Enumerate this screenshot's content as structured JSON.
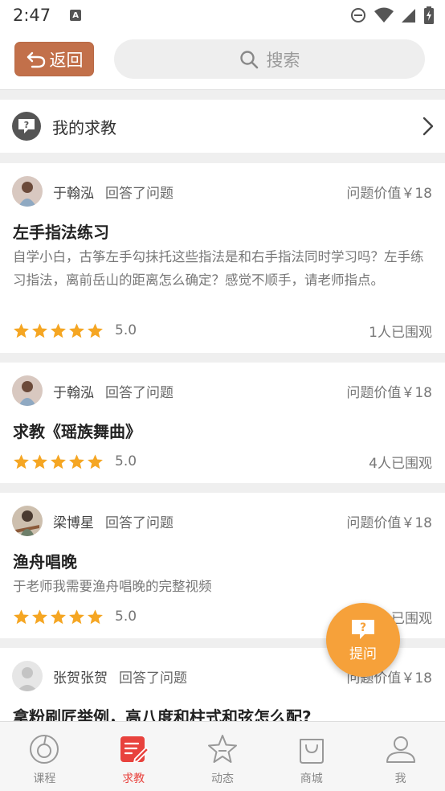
{
  "status": {
    "time": "2:47",
    "notif_letter": "A"
  },
  "header": {
    "back_label": "返回",
    "search_placeholder": "搜索"
  },
  "my_help": {
    "label": "我的求教"
  },
  "cards": [
    {
      "user": "于翰泓",
      "action": "回答了问题",
      "value": "问题价值￥18",
      "title": "左手指法练习",
      "desc": "自学小白，古筝左手勾抹托这些指法是和右手指法同时学习吗？左手练习指法，离前岳山的距离怎么确定？感觉不顺手，请老师指点。",
      "rating": 5,
      "score": "5.0",
      "watchers": "1人已围观"
    },
    {
      "user": "于翰泓",
      "action": "回答了问题",
      "value": "问题价值￥18",
      "title": "求教《瑶族舞曲》",
      "desc": "",
      "rating": 5,
      "score": "5.0",
      "watchers": "4人已围观"
    },
    {
      "user": "梁博星",
      "action": "回答了问题",
      "value": "问题价值￥18",
      "title": "渔舟唱晚",
      "desc": "于老师我需要渔舟唱晚的完整视频",
      "rating": 5,
      "score": "5.0",
      "watchers": "已围观"
    },
    {
      "user": "张贺张贺",
      "action": "回答了问题",
      "value": "问题价值￥18",
      "title": "拿粉刷匠举例，高八度和柱式和弦怎么配?"
    }
  ],
  "fab": {
    "label": "提问"
  },
  "tabs": [
    {
      "label": "课程",
      "icon": "course-icon",
      "active": false
    },
    {
      "label": "求教",
      "icon": "ask-icon",
      "active": true
    },
    {
      "label": "动态",
      "icon": "star-icon",
      "active": false
    },
    {
      "label": "商城",
      "icon": "shop-bag-icon",
      "active": false
    },
    {
      "label": "我",
      "icon": "profile-icon",
      "active": false
    }
  ],
  "colors": {
    "accent": "#e8423d",
    "back_button": "#c2704a",
    "fab": "#f6a13a",
    "star": "#f5a623"
  }
}
